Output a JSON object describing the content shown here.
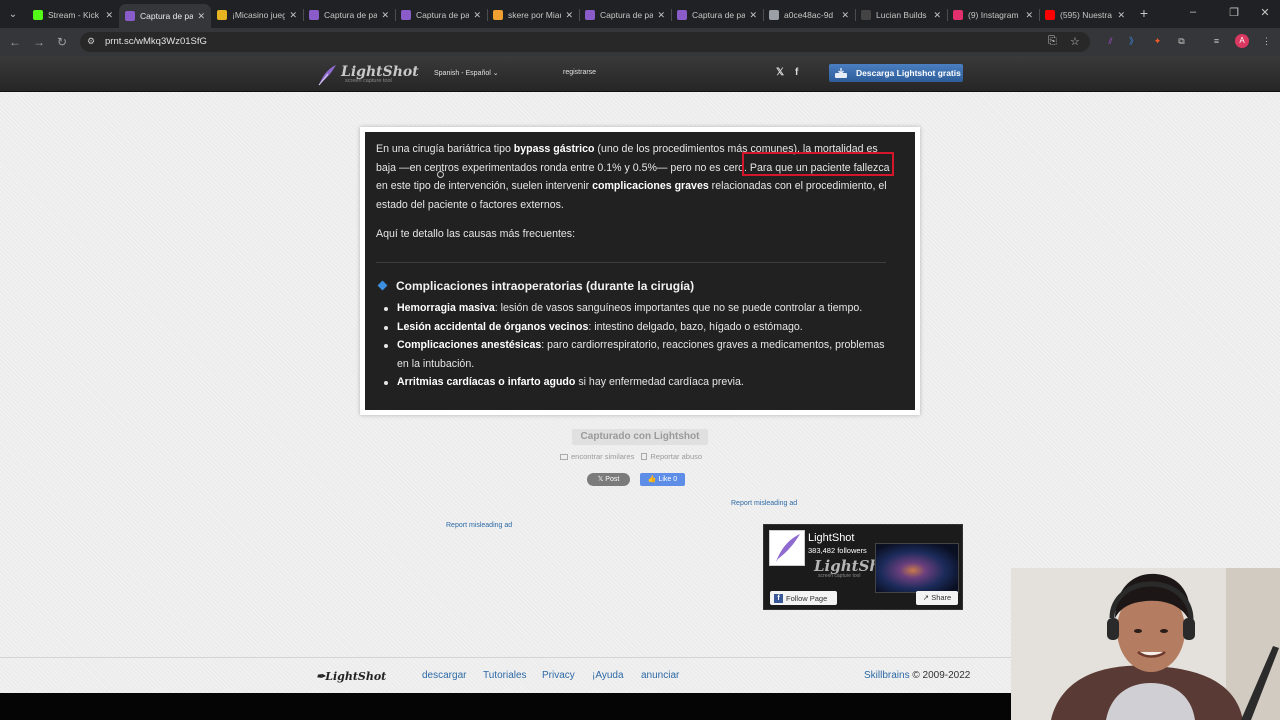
{
  "browser": {
    "tabs": [
      {
        "label": "Stream - Kick",
        "favicon": "kick-icon",
        "color": "#53fc18"
      },
      {
        "label": "Captura de pantalla",
        "favicon": "lightshot-icon",
        "color": "#8a5cc9",
        "active": true
      },
      {
        "label": "¡Micasino juega",
        "favicon": "casino-icon",
        "color": "#e6b422"
      },
      {
        "label": "Captura de pantalla",
        "favicon": "lightshot-icon",
        "color": "#8a5cc9"
      },
      {
        "label": "Captura de pantalla",
        "favicon": "lightshot-icon",
        "color": "#8a5cc9"
      },
      {
        "label": "skere por Miau",
        "favicon": "skere-icon",
        "color": "#f0a030"
      },
      {
        "label": "Captura de pantalla",
        "favicon": "lightshot-icon",
        "color": "#8a5cc9"
      },
      {
        "label": "Captura de pantalla",
        "favicon": "lightshot-icon",
        "color": "#8a5cc9"
      },
      {
        "label": "a0ce48ac-9d",
        "favicon": "globe-icon",
        "color": "#9aa0a6"
      },
      {
        "label": "Lucian Builds",
        "favicon": "lucian-icon",
        "color": "#444444"
      },
      {
        "label": "(9) Instagram",
        "favicon": "instagram-icon",
        "color": "#e1306c"
      },
      {
        "label": "(595) Nuestra",
        "favicon": "youtube-icon",
        "color": "#ff0000"
      }
    ],
    "url": "prnt.sc/wMkq3Wz01SfG",
    "profile_initial": "A"
  },
  "lightshot": {
    "logo_title": "LightShot",
    "logo_sub": "screen capture tool",
    "language": "Spanish - Español",
    "register": "registrarse",
    "download_button": "Descarga Lightshot gratis",
    "captured_label": "Capturado con Lightshot",
    "find_similar": "encontrar similares",
    "report_abuse": "Reportar abuso",
    "x_post": "Post",
    "fb_like": "Like 0",
    "report_ad_1": "Report misleading ad",
    "report_ad_2": "Report misleading ad",
    "fb_widget": {
      "name": "LightShot",
      "followers": "383,482 followers",
      "follow": "Follow Page",
      "share": "Share"
    },
    "footer": {
      "logo": "LightShot",
      "links": [
        "descargar",
        "Tutoriales",
        "Privacy",
        "¡Ayuda",
        "anunciar"
      ],
      "copyright_brand": "Skillbrains",
      "copyright_years": "© 2009-2022"
    }
  },
  "screenshot_text": {
    "p1_a": "En una cirugía bariátrica tipo ",
    "p1_b": "bypass gástrico",
    "p1_c": " (uno de los procedimientos más comunes), la mortalidad es baja —en centros experimentados ronda entre 0.1% y 0.5%— pero no es cero. Para que un paciente fallezca en este tipo de intervención, suelen intervenir ",
    "p1_d": "complicaciones graves",
    "p1_e": " relacionadas con el procedimiento, el estado del paciente o factores externos.",
    "p2": "Aquí te detallo las causas más frecuentes:",
    "section_title": "Complicaciones intraoperatorias (durante la cirugía)",
    "items": [
      {
        "bold": "Hemorragia masiva",
        "rest": ": lesión de vasos sanguíneos importantes que no se puede controlar a tiempo."
      },
      {
        "bold": "Lesión accidental de órganos vecinos",
        "rest": ": intestino delgado, bazo, hígado o estómago."
      },
      {
        "bold": "Complicaciones anestésicas",
        "rest": ": paro cardiorrespiratorio, reacciones graves a medicamentos, problemas en la intubación."
      },
      {
        "bold": "Arritmias cardíacas o infarto agudo",
        "rest": " si hay enfermedad cardíaca previa."
      }
    ]
  },
  "colors": {
    "highlight_box": "#d4162b",
    "download_button": "#3a6eaf",
    "link": "#2d6aa6"
  }
}
